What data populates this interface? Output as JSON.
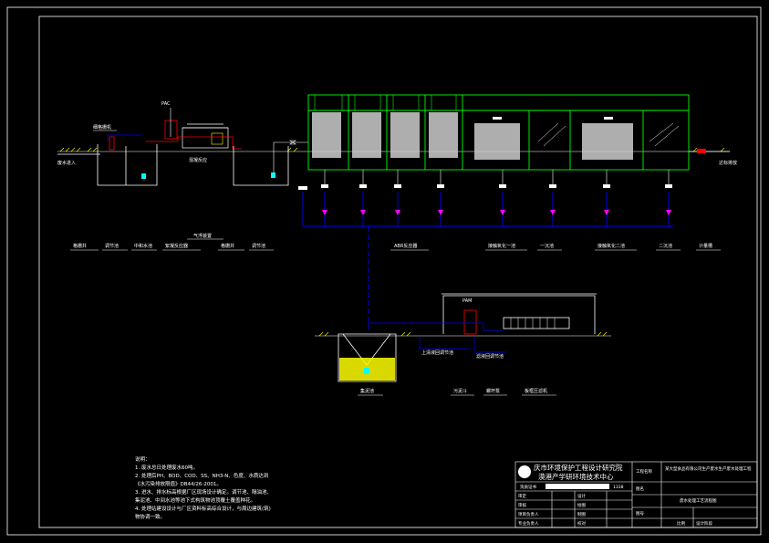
{
  "colors": {
    "background": "#000000",
    "frame": "#ffffff",
    "tank_outline": "#00ff00",
    "pipe_main": "#ffffff",
    "pipe_air": "#0000ff",
    "valve": "#ff00ff",
    "label_yellow": "#ffff00",
    "label_cyan": "#00ffff",
    "equipment_red": "#ff0000"
  },
  "process": {
    "inlet_label": "废水进入",
    "pac_label": "PAC",
    "grid_label": "细格栅机",
    "dosing_label": "混凝反应",
    "outlet_label": "达标排放",
    "air_pipe_label": "气浮装置",
    "pam_label": "PAM",
    "unit_labels": [
      "格栅井",
      "调节池",
      "中和水池",
      "絮凝反应器",
      "格栅井",
      "调节池",
      "ABR反应器",
      "接触氧化一池",
      "一沉池",
      "接触氧化二池",
      "二沉池",
      "计量槽"
    ],
    "sludge_tank_label": "集泥池",
    "sludge_labels": [
      "污泥斗",
      "螺杆泵",
      "板框压滤机"
    ],
    "line_labels": [
      "上清液回调节池",
      "滤液回调节池"
    ]
  },
  "notes": {
    "title": "说明：",
    "lines": [
      "1. 废水总日处理废水60吨。",
      "2. 处理后PH、BOD、COD、SS、NH3-N、色度、水质达到",
      "   《水污染排放限值》DB44/26-2001。",
      "3. 进水、排水标高根据厂区现场设计确定。调节池、隔油池、",
      "   集泥池、中间水池等池下式构筑物池顶覆土覆盖种花。",
      "4. 处理站建设设计与厂区资料标高综合设计，与周边建筑(筑)",
      "   物协调一致。"
    ]
  },
  "title_block": {
    "institute_line1": "庆市环境保护工程设计研究院",
    "institute_line2": "漠港产学研环境技术中心",
    "cert_label": "资质证书",
    "cert_number": "1338",
    "project_label": "工程名称",
    "project_value": "某大型食品有限公司生产废水生产废水处理工程",
    "drawing_label": "图名",
    "drawing_value": "废水处理工艺流程图",
    "rows": [
      {
        "left": "审定",
        "mid": "设计"
      },
      {
        "left": "审核",
        "mid": "绘图"
      },
      {
        "left": "项目负责人",
        "mid": "制图"
      },
      {
        "left": "专业负责人",
        "mid": "校对"
      },
      {
        "left": "专业负责",
        "mid": "审核"
      }
    ],
    "drawing_no_label": "图号",
    "scale_label": "比例",
    "date_label": "设计阶段"
  }
}
